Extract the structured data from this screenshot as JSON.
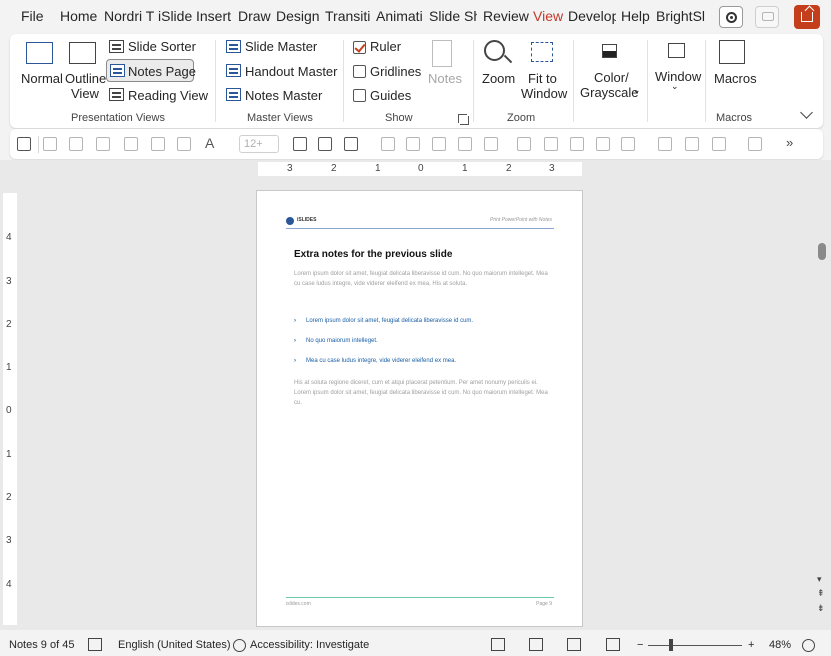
{
  "tabs": [
    {
      "label": "File",
      "active": false
    },
    {
      "label": "Home",
      "active": false
    },
    {
      "label": "Nordri T",
      "active": false
    },
    {
      "label": "iSlide",
      "active": false
    },
    {
      "label": "Insert",
      "active": false
    },
    {
      "label": "Draw",
      "active": false
    },
    {
      "label": "Design",
      "active": false
    },
    {
      "label": "Transitic",
      "active": false
    },
    {
      "label": "Animati",
      "active": false
    },
    {
      "label": "Slide Sh",
      "active": false
    },
    {
      "label": "Review",
      "active": false
    },
    {
      "label": "View",
      "active": true
    },
    {
      "label": "Develop",
      "active": false
    },
    {
      "label": "Help",
      "active": false
    },
    {
      "label": "BrightSl",
      "active": false
    }
  ],
  "ribbon": {
    "presentation_views": {
      "normal": "Normal",
      "outline_view_1": "Outline",
      "outline_view_2": "View",
      "slide_sorter": "Slide Sorter",
      "notes_page": "Notes Page",
      "reading_view": "Reading View",
      "group_label": "Presentation Views"
    },
    "master_views": {
      "slide_master": "Slide Master",
      "handout_master": "Handout Master",
      "notes_master": "Notes Master",
      "group_label": "Master Views"
    },
    "show": {
      "ruler": "Ruler",
      "gridlines": "Gridlines",
      "guides": "Guides",
      "notes": "Notes",
      "group_label": "Show",
      "ruler_checked": true,
      "gridlines_checked": false,
      "guides_checked": false
    },
    "zoom": {
      "zoom": "Zoom",
      "fit_1": "Fit to",
      "fit_2": "Window",
      "group_label": "Zoom"
    },
    "color": {
      "line1": "Color/",
      "line2": "Grayscale"
    },
    "window": {
      "label": "Window"
    },
    "macros": {
      "label": "Macros",
      "group_label": "Macros"
    }
  },
  "qat": {
    "font_size": "12+",
    "more": "»"
  },
  "ruler": {
    "h_ticks": [
      "3",
      "2",
      "1",
      "0",
      "1",
      "2",
      "3"
    ],
    "v_ticks": [
      "4",
      "3",
      "2",
      "1",
      "0",
      "1",
      "2",
      "3",
      "4"
    ]
  },
  "page": {
    "brand": "iSLIDES",
    "header_right": "Print PowerPoint with Notes",
    "title": "Extra notes for the previous slide",
    "para1": "Lorem ipsum dolor sit amet, feugiat delicata liberavisse id cum. No quo maiorum intelleget. Mea cu case ludus integre, vide viderer eleifend ex mea, His at soluta.",
    "bullets": [
      "Lorem ipsum dolor sit amet, feugiat delicata liberavisse id cum.",
      "No quo maiorum intelleget.",
      "Mea cu case ludus integre, vide viderer eleifend ex mea."
    ],
    "para2": "His at soluta regione diceret, cum et atqui placerat petentium. Per amet nonumy periculis ei. Lorem ipsum dolor sit amet, feugiat delicata liberavisse id cum. No quo maiorum intelleget. Mea cu.",
    "footer_left": "islides.com",
    "footer_right": "Page 9"
  },
  "status": {
    "slide_info": "Notes 9 of 45",
    "language": "English (United States)",
    "accessibility": "Accessibility: Investigate",
    "zoom_minus": "−",
    "zoom_plus": "+",
    "zoom_level": "48%"
  },
  "colors": {
    "accent": "#c43e1c",
    "ribbon_blue": "#2b579a",
    "link_blue": "#1a5fa8",
    "footer_green": "#6cc9a8"
  }
}
